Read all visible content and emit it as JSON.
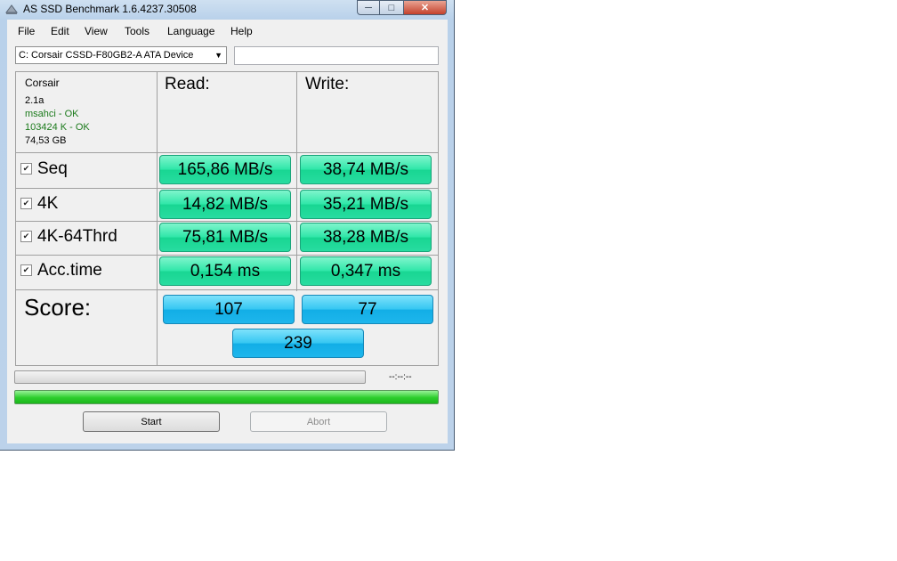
{
  "window": {
    "title": "AS SSD Benchmark 1.6.4237.30508"
  },
  "menu": [
    "File",
    "Edit",
    "View",
    "Tools",
    "Language",
    "Help"
  ],
  "device": {
    "selected": "C: Corsair CSSD-F80GB2-A ATA Device",
    "extra_field_value": ""
  },
  "info": {
    "vendor": "Corsair",
    "firmware": "2.1a",
    "driver": "msahci - OK",
    "alignment": "103424 K - OK",
    "size": "74,53 GB"
  },
  "headers": {
    "read": "Read:",
    "write": "Write:"
  },
  "rows": [
    {
      "label": "Seq",
      "checked": true,
      "read": "165,86 MB/s",
      "write": "38,74 MB/s"
    },
    {
      "label": "4K",
      "checked": true,
      "read": "14,82 MB/s",
      "write": "35,21 MB/s"
    },
    {
      "label": "4K-64Thrd",
      "checked": true,
      "read": "75,81 MB/s",
      "write": "38,28 MB/s"
    },
    {
      "label": "Acc.time",
      "checked": true,
      "read": "0,154 ms",
      "write": "0,347 ms"
    }
  ],
  "score": {
    "label": "Score:",
    "read": "107",
    "write": "77",
    "total": "239"
  },
  "progress": {
    "time": "--:--:--",
    "main_progress_fraction": 1.0
  },
  "buttons": {
    "start": "Start",
    "abort": "Abort"
  },
  "colors": {
    "value_box": "#2ee6a8",
    "score_box": "#34c6f2",
    "progress_green": "#2ccd2c"
  }
}
